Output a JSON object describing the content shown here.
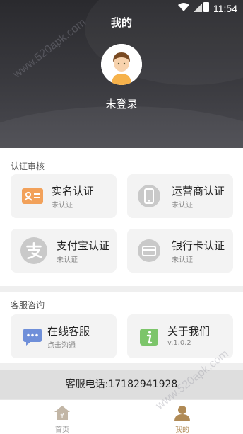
{
  "status_bar": {
    "time": "11:54"
  },
  "header": {
    "title": "我的",
    "login_status": "未登录"
  },
  "verification": {
    "section_title": "认证审核",
    "cards": [
      {
        "title": "实名认证",
        "status": "未认证",
        "icon": "id-card-icon",
        "color": "#f2a15a"
      },
      {
        "title": "运营商认证",
        "status": "未认证",
        "icon": "phone-icon",
        "color": "#c9c9c9"
      },
      {
        "title": "支付宝认证",
        "status": "未认证",
        "icon": "alipay-icon",
        "color": "#c9c9c9"
      },
      {
        "title": "银行卡认证",
        "status": "未认证",
        "icon": "bank-card-icon",
        "color": "#c9c9c9"
      }
    ]
  },
  "support": {
    "section_title": "客服咨询",
    "cards": [
      {
        "title": "在线客服",
        "subtitle": "点击沟通",
        "icon": "chat-icon",
        "color": "#6f8fd9"
      },
      {
        "title": "关于我们",
        "subtitle": "v.1.0.2",
        "icon": "info-icon",
        "color": "#7cc56a"
      }
    ]
  },
  "hotline": "客服电话:17182941928",
  "tabbar": {
    "tabs": [
      {
        "label": "首页",
        "icon": "home-icon",
        "active": false
      },
      {
        "label": "我的",
        "icon": "profile-icon",
        "active": true
      }
    ],
    "active_color": "#b08a55"
  },
  "watermark": "www.520apk.com"
}
